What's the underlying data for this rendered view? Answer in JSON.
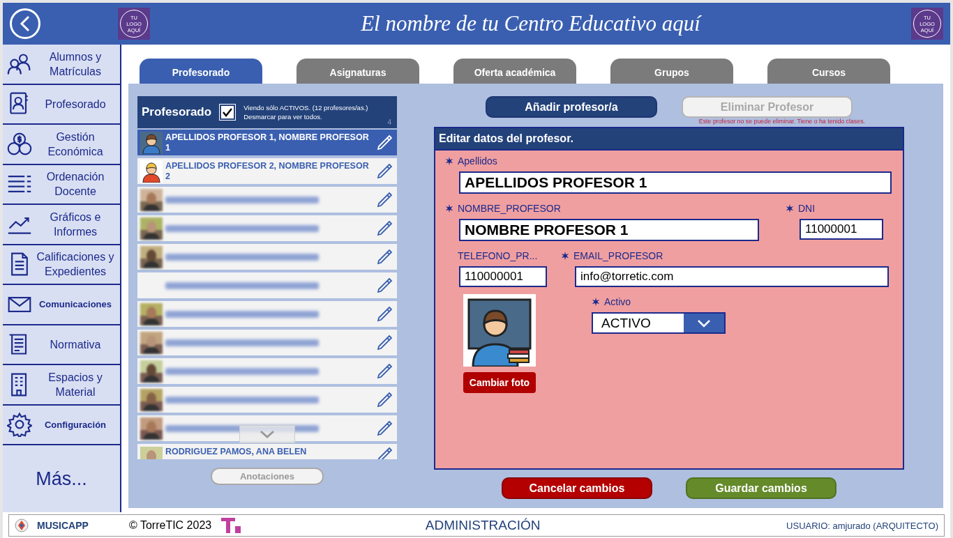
{
  "header": {
    "title": "El nombre de tu Centro Educativo aquí",
    "logo_left": [
      "TU",
      "LOGO",
      "AQUÍ"
    ],
    "logo_right": [
      "TU",
      "LOGO",
      "AQUÍ"
    ]
  },
  "sidebar": {
    "items": [
      {
        "label": "Alumnos y Matrículas",
        "compact": false
      },
      {
        "label": "Profesorado",
        "compact": false
      },
      {
        "label": "Gestión Económica",
        "compact": false
      },
      {
        "label": "Ordenación Docente",
        "compact": false
      },
      {
        "label": "Gráficos e Informes",
        "compact": false
      },
      {
        "label": "Calificaciones y Expedientes",
        "compact": false
      },
      {
        "label": "Comunicaciones",
        "compact": true
      },
      {
        "label": "Normativa",
        "compact": false
      },
      {
        "label": "Espacios y Material",
        "compact": false
      },
      {
        "label": "Configuración",
        "compact": true
      }
    ],
    "more": "Más..."
  },
  "tabs": [
    {
      "label": "Profesorado",
      "selected": true
    },
    {
      "label": "Asignaturas",
      "selected": false
    },
    {
      "label": "Oferta académica",
      "selected": false
    },
    {
      "label": "Grupos",
      "selected": false
    },
    {
      "label": "Cursos",
      "selected": false
    }
  ],
  "list": {
    "title": "Profesorado",
    "checked": true,
    "note": [
      "Viendo sólo ACTIVOS. (12 profesores/as.)",
      "Desmarcar para ver todos."
    ],
    "count": "4",
    "rows": [
      {
        "kind": "cartoon",
        "label": "APELLIDOS PROFESOR 1, NOMBRE PROFESOR 1",
        "selected": true
      },
      {
        "kind": "cartoon",
        "label": "APELLIDOS PROFESOR 2, NOMBRE PROFESOR 2",
        "selected": false
      },
      {
        "kind": "blurred",
        "photo": true,
        "selected": false
      },
      {
        "kind": "blurred",
        "photo": true,
        "selected": false
      },
      {
        "kind": "blurred",
        "photo": true,
        "selected": false
      },
      {
        "kind": "blurred",
        "photo": false,
        "selected": false
      },
      {
        "kind": "blurred",
        "photo": true,
        "selected": false
      },
      {
        "kind": "blurred",
        "photo": true,
        "selected": false
      },
      {
        "kind": "blurred",
        "photo": true,
        "selected": false
      },
      {
        "kind": "blurred",
        "photo": true,
        "selected": false
      },
      {
        "kind": "blurred",
        "photo": true,
        "selected": false
      },
      {
        "label": "RODRIGUEZ PAMOS, ANA BELEN",
        "selected": false
      }
    ],
    "notes_button": {
      "label": "Anotaciones",
      "disabled": true
    }
  },
  "actions": {
    "add": {
      "label": "Añadir profesor/a",
      "disabled": false
    },
    "delete": {
      "label": "Eliminar Profesor",
      "disabled": true
    },
    "warning": "Este profesor no se puede eliminar. Tiene o ha tenido clases."
  },
  "form": {
    "title": "Editar datos del profesor.",
    "fields": [
      {
        "kind": "text",
        "label": "Apellidos",
        "required": true,
        "value": "APELLIDOS PROFESOR 1",
        "large": true
      },
      {
        "kind": "text",
        "label": "NOMBRE_PROFESOR",
        "required": true,
        "value": "NOMBRE PROFESOR 1",
        "large": true
      },
      {
        "kind": "text",
        "label": "DNI",
        "required": true,
        "value": "11000001",
        "large": false
      },
      {
        "kind": "text",
        "label": "TELEFONO_PR...",
        "required": false,
        "value": "110000001",
        "large": false
      },
      {
        "kind": "text",
        "label": "EMAIL_PROFESOR",
        "required": true,
        "value": "info@torretic.com",
        "large": false
      },
      {
        "kind": "select",
        "label": "Activo",
        "required": true,
        "value": "ACTIVO"
      }
    ],
    "photo_button": "Cambiar foto"
  },
  "buttons": [
    {
      "label": "Cancelar cambios",
      "kind": "cancel"
    },
    {
      "label": "Guardar cambios",
      "kind": "save"
    }
  ],
  "footer": {
    "app": "MUSICAPP",
    "copyright": "©  TorreTIC  2023",
    "section": "ADMINISTRACIÓN",
    "user": "USUARIO: amjurado (ARQUITECTO)"
  }
}
